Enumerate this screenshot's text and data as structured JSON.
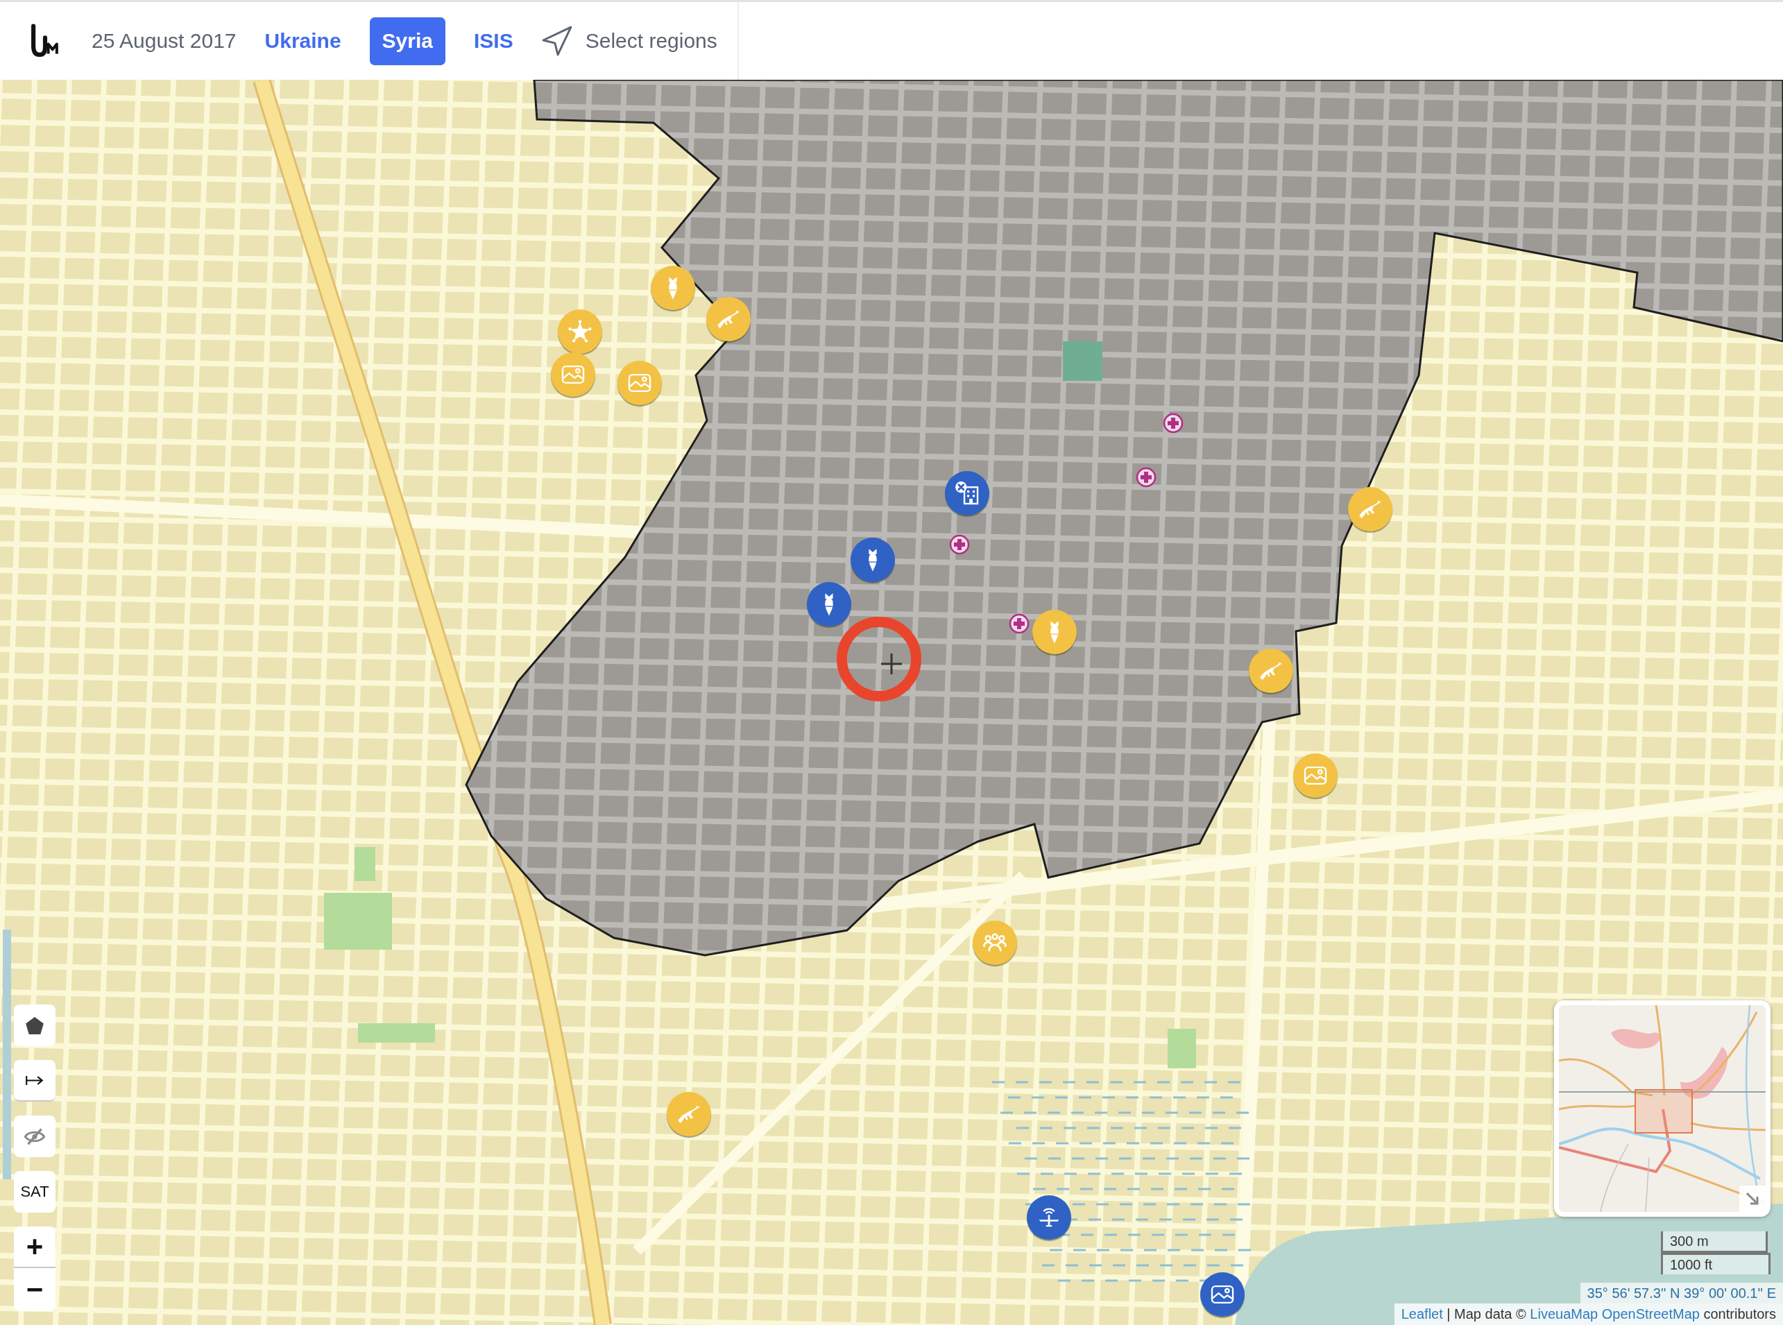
{
  "header": {
    "date": "25 August 2017",
    "tabs": [
      {
        "label": "Ukraine",
        "selected": false
      },
      {
        "label": "Syria",
        "selected": true
      },
      {
        "label": "ISIS",
        "selected": false
      }
    ],
    "select_regions": "Select regions"
  },
  "map": {
    "markers": [
      {
        "kind": "bomb",
        "color": "#f3c244"
      },
      {
        "kind": "rifle",
        "color": "#f3c244"
      },
      {
        "kind": "star",
        "color": "#f3c244"
      },
      {
        "kind": "photo",
        "color": "#f3c244"
      },
      {
        "kind": "photo",
        "color": "#f3c244"
      },
      {
        "kind": "building",
        "color": "#2f62c4"
      },
      {
        "kind": "bomb",
        "color": "#2f62c4"
      },
      {
        "kind": "bomb",
        "color": "#2f62c4"
      },
      {
        "kind": "bomb",
        "color": "#f3c244"
      },
      {
        "kind": "rifle",
        "color": "#f3c244"
      },
      {
        "kind": "rifle",
        "color": "#f3c244"
      },
      {
        "kind": "photo",
        "color": "#f3c244"
      },
      {
        "kind": "group",
        "color": "#f3c244"
      },
      {
        "kind": "rifle",
        "color": "#f3c244"
      },
      {
        "kind": "drone",
        "color": "#2f62c4"
      },
      {
        "kind": "photo",
        "color": "#2f62c4"
      }
    ],
    "controls": [
      {
        "kind": "polygon"
      },
      {
        "kind": "arrow"
      },
      {
        "kind": "hide"
      },
      {
        "kind": "sat",
        "label": "SAT"
      }
    ],
    "zoom": {
      "in": "+",
      "out": "−"
    },
    "scale": {
      "metric": "300 m",
      "imperial": "1000 ft"
    },
    "coordinates": "35° 56' 57.3'' N 39° 00' 00.1'' E",
    "attribution": [
      {
        "kind": "link",
        "text": "Leaflet"
      },
      {
        "kind": "text",
        "text": "| Map data ©"
      },
      {
        "kind": "link",
        "text": "LiveuaMap"
      },
      {
        "kind": "link",
        "text": "OpenStreetMap"
      },
      {
        "kind": "text",
        "text": "contributors"
      }
    ]
  }
}
